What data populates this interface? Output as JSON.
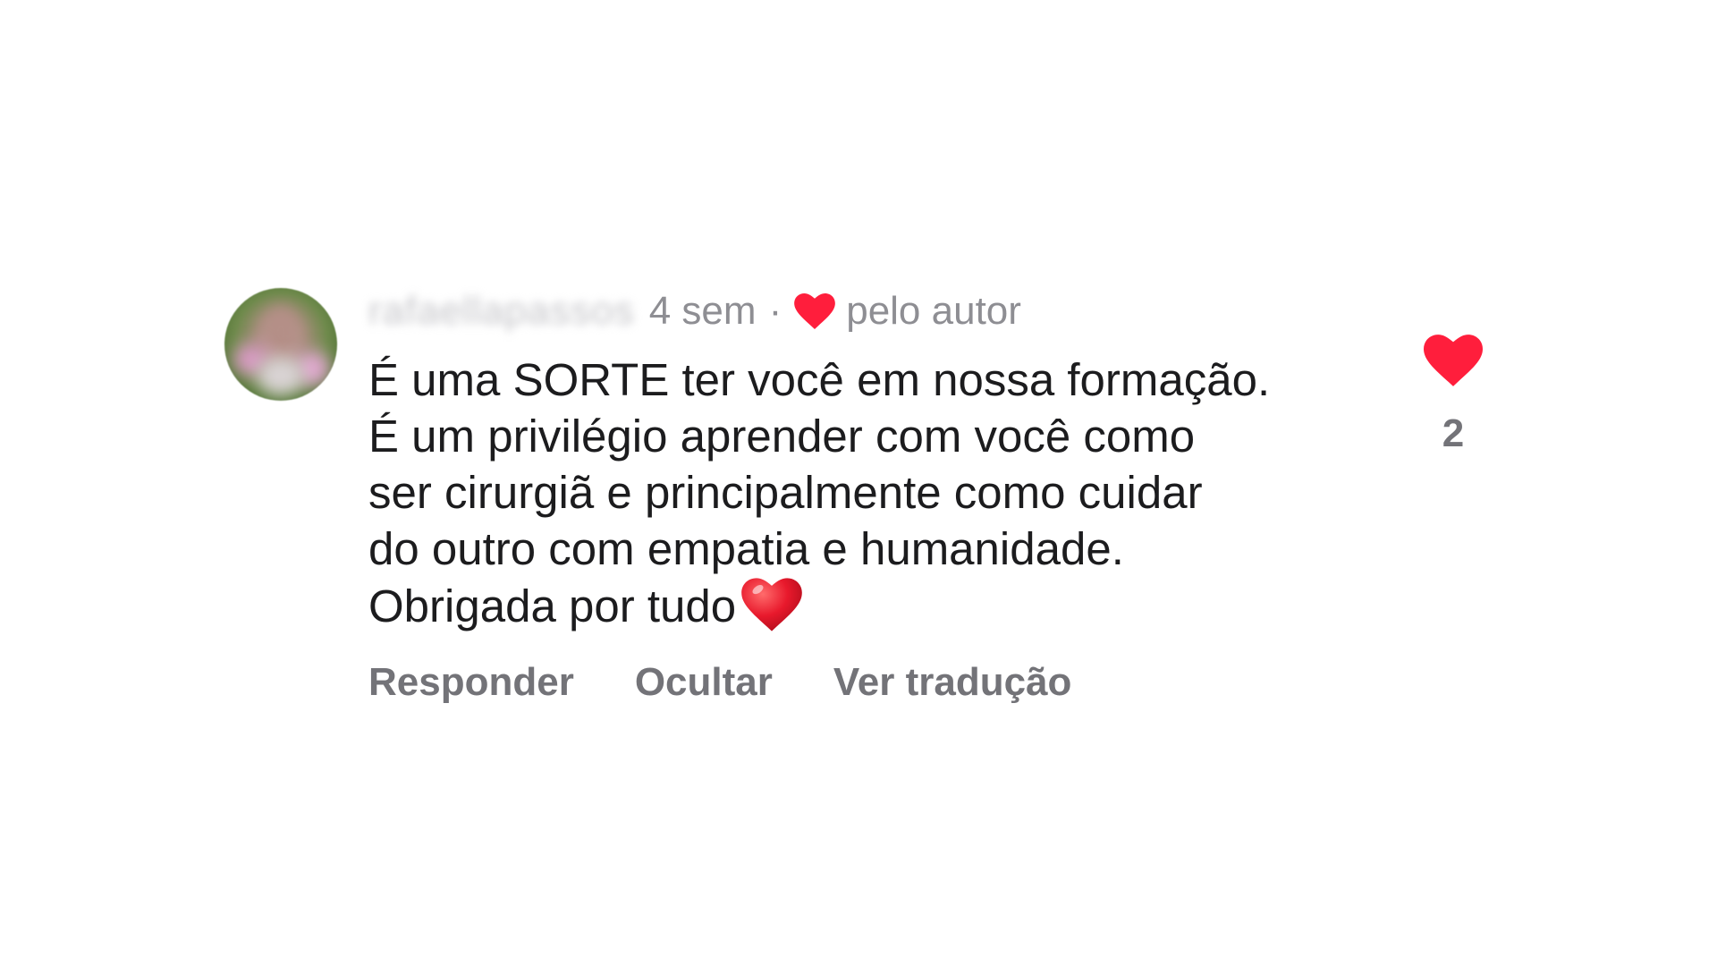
{
  "comment": {
    "username": "rafaellapassos",
    "time": "4 sem",
    "separator": "·",
    "liked_by_author": "pelo autor",
    "text": "É uma SORTE ter você em nossa formação.\nÉ um privilégio aprender com você como\nser cirurgiã e principalmente como cuidar\ndo outro com empatia e humanidade.\nObrigada por tudo",
    "emoji": "red-heart-emoji",
    "like_count": "2"
  },
  "actions": {
    "reply": "Responder",
    "hide": "Ocultar",
    "translate": "Ver tradução"
  },
  "icons": {
    "author_like": "heart-icon",
    "like_button": "heart-icon",
    "avatar": "profile-photo-blurred"
  },
  "colors": {
    "heart": "#ff1e3c",
    "text": "#1c1c1e",
    "meta": "#8e8e93",
    "action": "#737378"
  }
}
